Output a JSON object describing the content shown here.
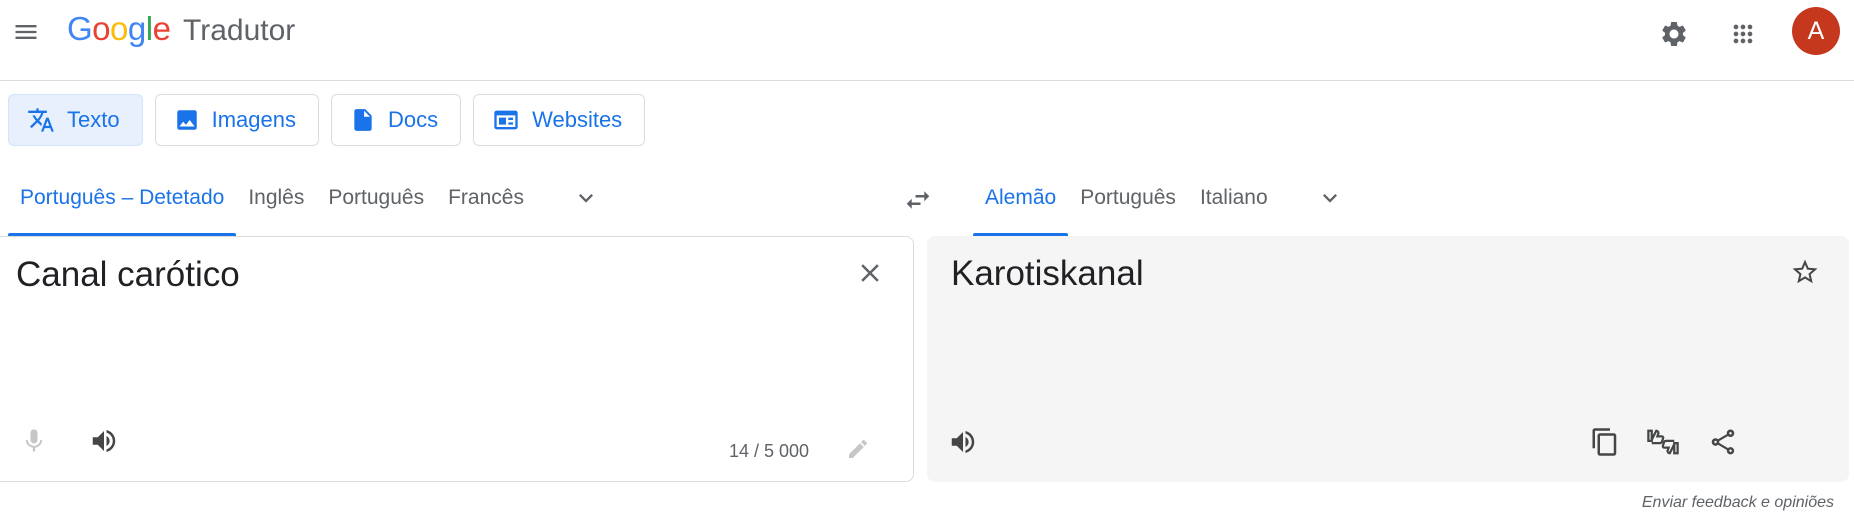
{
  "header": {
    "logo_letters": [
      "G",
      "o",
      "o",
      "g",
      "l",
      "e"
    ],
    "product": "Tradutor",
    "avatar_letter": "A",
    "avatar_color": "#c5381e"
  },
  "modes": [
    {
      "label": "Texto",
      "icon": "translate-icon",
      "active": true
    },
    {
      "label": "Imagens",
      "icon": "image-icon",
      "active": false
    },
    {
      "label": "Docs",
      "icon": "document-icon",
      "active": false
    },
    {
      "label": "Websites",
      "icon": "website-icon",
      "active": false
    }
  ],
  "source_languages": [
    "Português – Detetado",
    "Inglês",
    "Português",
    "Francês"
  ],
  "target_languages": [
    "Alemão",
    "Português",
    "Italiano"
  ],
  "source": {
    "text": "Canal carótico",
    "char_count": "14 / 5 000"
  },
  "target": {
    "text": "Karotiskanal"
  },
  "feedback_link": "Enviar feedback e opiniões",
  "colors": {
    "accent": "#1a73e8",
    "active_chip_bg": "#e8f0fe",
    "target_panel_bg": "#f5f5f5"
  }
}
